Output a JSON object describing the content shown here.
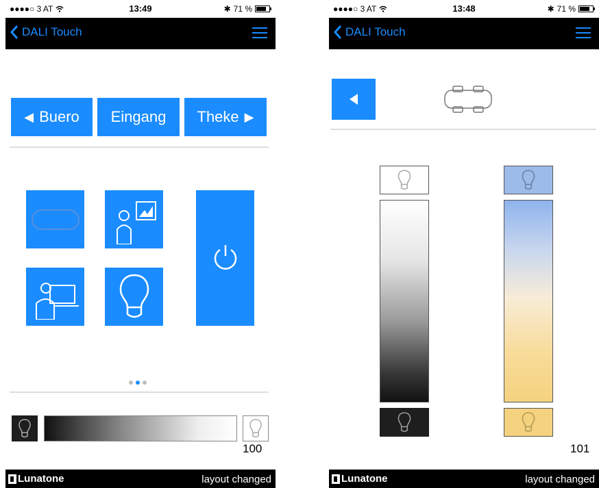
{
  "left_screen": {
    "status": {
      "carrier": "●●●●○ 3 AT",
      "time": "13:49",
      "battery": "71 %",
      "bluetooth": "✱"
    },
    "nav": {
      "back_label": "DALI Touch"
    },
    "rooms": {
      "prev": "Buero",
      "current": "Eingang",
      "next": "Theke"
    },
    "page_indicator": {
      "pages": 3,
      "active": 2
    },
    "dim_value": "100",
    "footer": {
      "brand": "Lunatone",
      "status": "layout changed"
    }
  },
  "right_screen": {
    "status": {
      "carrier": "●●●●○ 3 AT",
      "time": "13:48",
      "battery": "71 %",
      "bluetooth": "✱"
    },
    "nav": {
      "back_label": "DALI Touch"
    },
    "value": "101",
    "footer": {
      "brand": "Lunatone",
      "status": "layout changed"
    }
  },
  "colors": {
    "accent": "#1a8cff",
    "bar": "#000000",
    "warm": "#f4d27f",
    "cool": "#8fb3ee"
  },
  "icons": [
    "chevron-left-icon",
    "menu-icon",
    "table-icon",
    "presentation-icon",
    "projector-icon",
    "bulb-icon",
    "power-icon"
  ]
}
